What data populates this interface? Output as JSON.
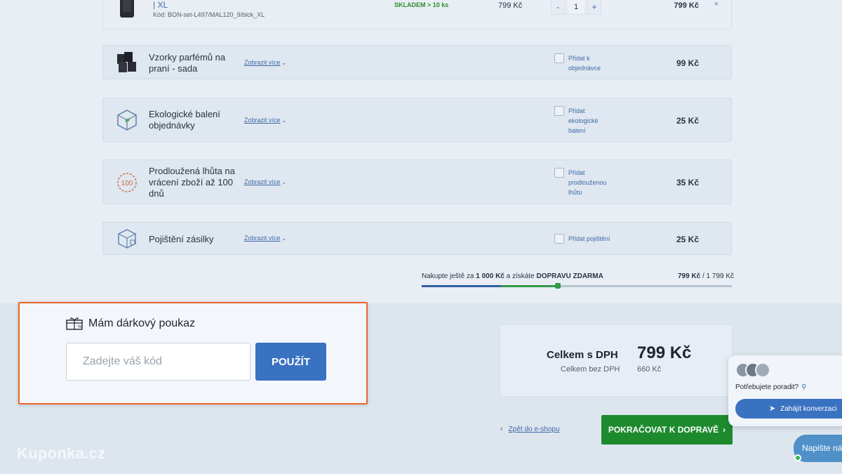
{
  "product": {
    "title": "| XL",
    "code": "Kód: BON-set-L497/MAL120_9/blck_XL",
    "stock": "SKLADEM > 10 ks",
    "unit_price": "799 Kč",
    "qty_minus": "-",
    "quantity": "1",
    "qty_plus": "+",
    "total": "799 Kč",
    "remove": "×"
  },
  "extras": [
    {
      "title": "Vzorky parfémů na praní - sada",
      "more": "Zobrazit více",
      "add_label": "Přidat k objednávce",
      "price": "99 Kč",
      "icon": "perfume-samples-icon"
    },
    {
      "title": "Ekologické balení objednávky",
      "more": "Zobrazit více",
      "add_label": "Přidat ekologické balení",
      "price": "25 Kč",
      "icon": "eco-package-icon"
    },
    {
      "title": "Prodloužená lhůta na vrácení zboží až 100 dnů",
      "more": "Zobrazit více",
      "add_label": "Přidat prodlouženou lhůtu",
      "price": "35 Kč",
      "icon": "return-100-icon",
      "icon_text": "100"
    },
    {
      "title": "Pojištění zásilky",
      "more": "Zobrazit více",
      "add_label": "Přidat pojištění",
      "price": "25 Kč",
      "icon": "insurance-box-icon"
    }
  ],
  "shipping": {
    "text_prefix": "Nakupte ještě za",
    "amount": "1 000 Kč",
    "text_middle": "a získáte",
    "free": "DOPRAVU ZDARMA",
    "current": "799 Kč",
    "threshold": "/ 1 799 Kč",
    "progress": 0.44
  },
  "coupon": {
    "heading": "Mám dárkový poukaz",
    "placeholder": "Zadejte váš kód",
    "value": "",
    "apply": "POUŽÍT"
  },
  "summary": {
    "total_label": "Celkem s DPH",
    "total_value": "799 Kč",
    "net_label": "Celkem bez DPH",
    "net_value": "660 Kč"
  },
  "navigation": {
    "back": "Zpět do e-shopu",
    "continue": "POKRAČOVAT K DOPRAVĚ"
  },
  "chat": {
    "question": "Potřebujete poradit?",
    "start": "Zahájit konverzaci",
    "write": "Napište nám"
  },
  "watermark": "Kuponka.cz",
  "colors": {
    "accent_blue": "#3a72c2",
    "continue_green": "#1d8a2e",
    "stock_green": "#2e8b2e",
    "highlight_orange": "#e8662a"
  }
}
